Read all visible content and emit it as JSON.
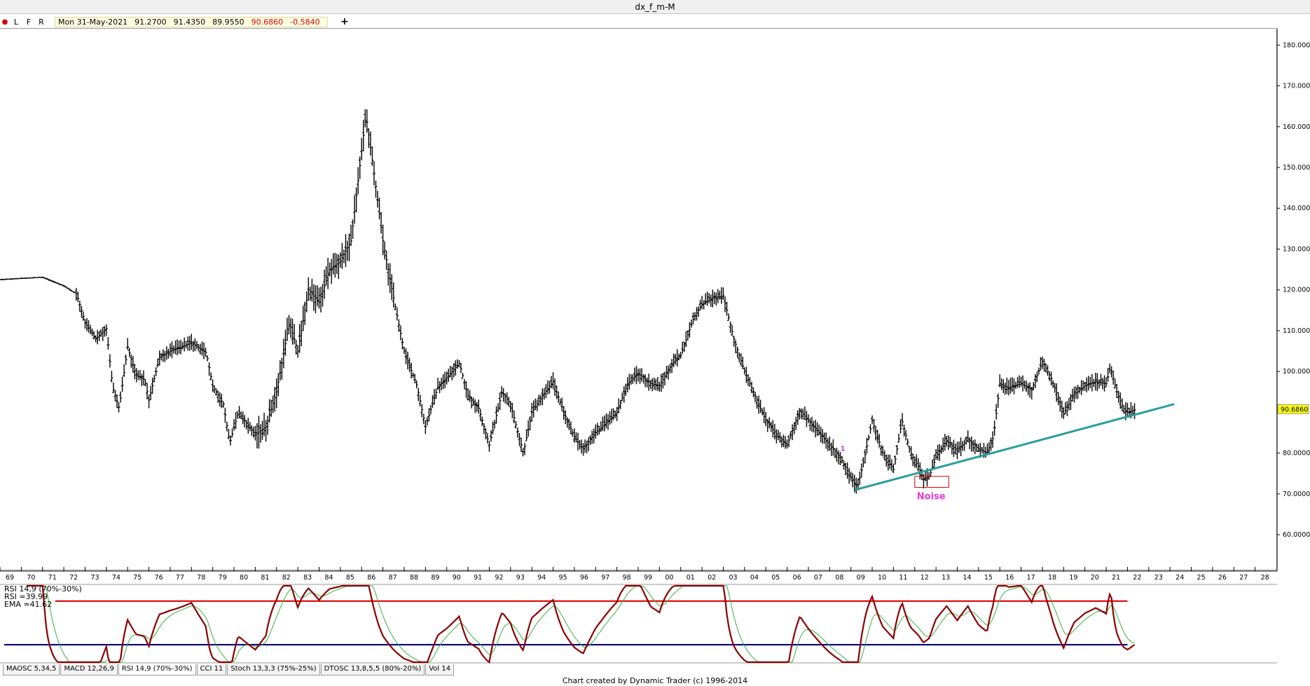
{
  "window": {
    "title": "dx_f_m-M"
  },
  "toolbar": {
    "modes": [
      "L",
      "F",
      "R"
    ],
    "bar_info": {
      "date": "Mon 31-May-2021",
      "open": "91.2700",
      "high": "91.4350",
      "low": "89.9550",
      "close": "90.6860",
      "change": "-0.5840"
    },
    "add_label": "+"
  },
  "price_axis": {
    "labels": [
      "180.0000",
      "170.0000",
      "160.0000",
      "150.0000",
      "140.0000",
      "130.0000",
      "120.0000",
      "110.0000",
      "100.0000",
      "80.0000",
      "70.0000",
      "60.0000"
    ],
    "last_price": "90.6860"
  },
  "time_axis": {
    "labels": [
      "69",
      "70",
      "71",
      "72",
      "73",
      "74",
      "75",
      "76",
      "77",
      "78",
      "79",
      "80",
      "81",
      "82",
      "83",
      "84",
      "85",
      "86",
      "87",
      "88",
      "89",
      "90",
      "91",
      "92",
      "93",
      "94",
      "95",
      "96",
      "97",
      "98",
      "99",
      "00",
      "01",
      "02",
      "03",
      "04",
      "05",
      "06",
      "07",
      "08",
      "09",
      "10",
      "11",
      "12",
      "13",
      "14",
      "15",
      "16",
      "17",
      "18",
      "19",
      "20",
      "21",
      "22",
      "23",
      "24",
      "25",
      "26",
      "27",
      "28"
    ]
  },
  "annotations": {
    "noise_label": "Noise",
    "marker_label": "1"
  },
  "colors": {
    "trendline": "#2a9d9d",
    "noise": "#e23bd4",
    "rsi_line": "#8b0000",
    "ema_line": "#3cb043",
    "overbought": "#e00000",
    "oversold": "#000080",
    "price_bars": "#000000"
  },
  "chart_data": {
    "type": "ohlc-bar",
    "symbol": "dx_f_m-M",
    "ylim": [
      54,
      184
    ],
    "x_range": [
      1968.0,
      2028.0
    ],
    "price_anchors": [
      [
        1968.0,
        122.5
      ],
      [
        1970.0,
        123.1
      ],
      [
        1971.0,
        121.0
      ],
      [
        1971.6,
        119.0
      ],
      [
        1972.0,
        112.0
      ],
      [
        1972.5,
        108.0
      ],
      [
        1973.0,
        110.5
      ],
      [
        1973.3,
        96.0
      ],
      [
        1973.6,
        91.0
      ],
      [
        1974.0,
        106.0
      ],
      [
        1974.4,
        99.0
      ],
      [
        1974.8,
        98.0
      ],
      [
        1975.0,
        93.0
      ],
      [
        1975.5,
        103.5
      ],
      [
        1976.0,
        105.0
      ],
      [
        1977.0,
        107.0
      ],
      [
        1977.7,
        104.5
      ],
      [
        1978.0,
        96.5
      ],
      [
        1978.5,
        92.0
      ],
      [
        1978.8,
        82.5
      ],
      [
        1979.2,
        90.0
      ],
      [
        1980.0,
        84.5
      ],
      [
        1980.5,
        86.5
      ],
      [
        1981.0,
        95.0
      ],
      [
        1981.6,
        112.0
      ],
      [
        1982.0,
        105.0
      ],
      [
        1982.5,
        120.0
      ],
      [
        1983.0,
        117.0
      ],
      [
        1983.5,
        125.0
      ],
      [
        1984.0,
        127.0
      ],
      [
        1984.5,
        132.0
      ],
      [
        1985.2,
        163.0
      ],
      [
        1985.6,
        148.0
      ],
      [
        1986.0,
        132.0
      ],
      [
        1986.5,
        118.0
      ],
      [
        1987.0,
        105.0
      ],
      [
        1987.6,
        96.5
      ],
      [
        1988.0,
        86.5
      ],
      [
        1988.6,
        96.5
      ],
      [
        1989.0,
        98.5
      ],
      [
        1989.6,
        102.0
      ],
      [
        1990.0,
        94.0
      ],
      [
        1990.5,
        91.0
      ],
      [
        1991.0,
        82.0
      ],
      [
        1991.6,
        95.0
      ],
      [
        1992.0,
        92.0
      ],
      [
        1992.6,
        80.0
      ],
      [
        1993.0,
        90.0
      ],
      [
        1993.5,
        94.0
      ],
      [
        1994.0,
        97.5
      ],
      [
        1994.5,
        90.0
      ],
      [
        1995.0,
        84.0
      ],
      [
        1995.4,
        81.0
      ],
      [
        1996.0,
        85.0
      ],
      [
        1996.6,
        88.0
      ],
      [
        1997.0,
        90.0
      ],
      [
        1997.5,
        97.0
      ],
      [
        1998.0,
        99.5
      ],
      [
        1998.6,
        97.0
      ],
      [
        1999.0,
        96.5
      ],
      [
        1999.6,
        102.0
      ],
      [
        2000.0,
        104.0
      ],
      [
        2000.6,
        113.0
      ],
      [
        2001.0,
        116.5
      ],
      [
        2001.5,
        118.0
      ],
      [
        2002.0,
        118.5
      ],
      [
        2002.5,
        108.0
      ],
      [
        2003.0,
        100.0
      ],
      [
        2003.5,
        94.0
      ],
      [
        2004.0,
        88.0
      ],
      [
        2004.6,
        84.0
      ],
      [
        2005.0,
        82.0
      ],
      [
        2005.6,
        90.5
      ],
      [
        2006.0,
        88.0
      ],
      [
        2006.6,
        84.5
      ],
      [
        2007.0,
        82.0
      ],
      [
        2007.5,
        79.0
      ],
      [
        2008.0,
        74.0
      ],
      [
        2008.3,
        71.5
      ],
      [
        2008.6,
        78.0
      ],
      [
        2009.0,
        88.0
      ],
      [
        2009.5,
        80.0
      ],
      [
        2010.0,
        76.0
      ],
      [
        2010.4,
        88.0
      ],
      [
        2010.8,
        80.0
      ],
      [
        2011.2,
        76.5
      ],
      [
        2011.4,
        73.5
      ],
      [
        2011.7,
        74.5
      ],
      [
        2012.0,
        79.0
      ],
      [
        2012.5,
        83.0
      ],
      [
        2013.0,
        80.5
      ],
      [
        2013.5,
        83.5
      ],
      [
        2014.0,
        81.0
      ],
      [
        2014.4,
        80.0
      ],
      [
        2014.7,
        84.0
      ],
      [
        2015.0,
        97.0
      ],
      [
        2015.4,
        96.0
      ],
      [
        2016.0,
        97.0
      ],
      [
        2016.5,
        95.5
      ],
      [
        2017.0,
        102.5
      ],
      [
        2017.4,
        98.5
      ],
      [
        2017.8,
        93.0
      ],
      [
        2018.0,
        89.5
      ],
      [
        2018.5,
        94.5
      ],
      [
        2019.0,
        96.5
      ],
      [
        2019.5,
        97.5
      ],
      [
        2020.0,
        97.0
      ],
      [
        2020.2,
        101.0
      ],
      [
        2020.5,
        95.0
      ],
      [
        2020.8,
        91.0
      ],
      [
        2021.0,
        90.0
      ],
      [
        2021.4,
        90.7
      ]
    ],
    "trendline": {
      "start": [
        2008.2,
        71.0
      ],
      "end": [
        2023.2,
        92.0
      ]
    },
    "noise_box": {
      "x": [
        2011.0,
        2012.6
      ],
      "y": [
        71.6,
        74.3
      ]
    },
    "indicator": {
      "type": "line",
      "labels": [
        "RSI 14,9 (70%-30%)",
        "RSI =39.99",
        "EMA =41.62"
      ],
      "overbought": 70,
      "oversold": 30,
      "ylim": [
        14,
        84
      ],
      "rsi_value": 39.99,
      "ema_value": 41.62
    }
  },
  "tabs": [
    "MAOSC 5,34,5",
    "MACD 12,26,9",
    "RSI 14,9 (70%-30%)",
    "CCI 11",
    "Stoch 13,3,3 (75%-25%)",
    "DTOSC 13,8,5,5 (80%-20%)",
    "Vol 14"
  ],
  "footer": {
    "credit": "Chart created by Dynamic Trader  (c)  1996-2014"
  }
}
